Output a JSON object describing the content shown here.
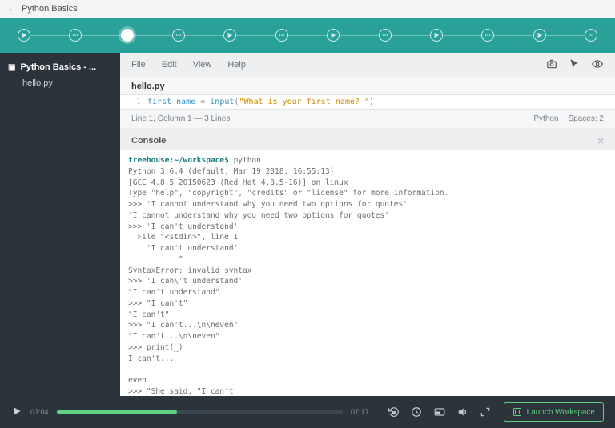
{
  "header": {
    "title": "Python Basics"
  },
  "sidebar": {
    "folder_name": "Python Basics - ...",
    "file_name": "hello.py"
  },
  "menu": {
    "file": "File",
    "edit": "Edit",
    "view": "View",
    "help": "Help"
  },
  "editor": {
    "filename": "hello.py",
    "line_number": "1",
    "var": "first_name",
    "eq": " = ",
    "fn": "input",
    "paren_open": "(",
    "string": "\"What is your first name?  \"",
    "paren_close": ")"
  },
  "status": {
    "position": "Line 1, Column 1 — 3 Lines",
    "lang": "Python",
    "spaces": "Spaces: 2"
  },
  "console": {
    "title": "Console",
    "prompt": "treehouse:~/workspace$",
    "cmd": " python",
    "body": "Python 3.6.4 (default, Mar 19 2018, 16:55:13)\n[GCC 4.8.5 20150623 (Red Hat 4.8.5-16)] on linux\nType \"help\", \"copyright\", \"credits\" or \"license\" for more information.\n>>> 'I cannot understand why you need two options for quotes'\n'I cannot understand why you need two options for quotes'\n>>> 'I can't understand'\n  File \"<stdin>\", line 1\n    'I can't understand'\n           ^\nSyntaxError: invalid syntax\n>>> 'I can\\'t understand'\n\"I can't understand\"\n>>> \"I can't\"\n\"I can't\"\n>>> \"I can't...\\n\\neven\"\n\"I can't...\\n\\neven\"\n>>> print(_)\nI can't...\n\neven\n>>> \"She said, \"I can't"
  },
  "player": {
    "current": "03:04",
    "total": "07:17",
    "launch": "Launch Workspace"
  }
}
